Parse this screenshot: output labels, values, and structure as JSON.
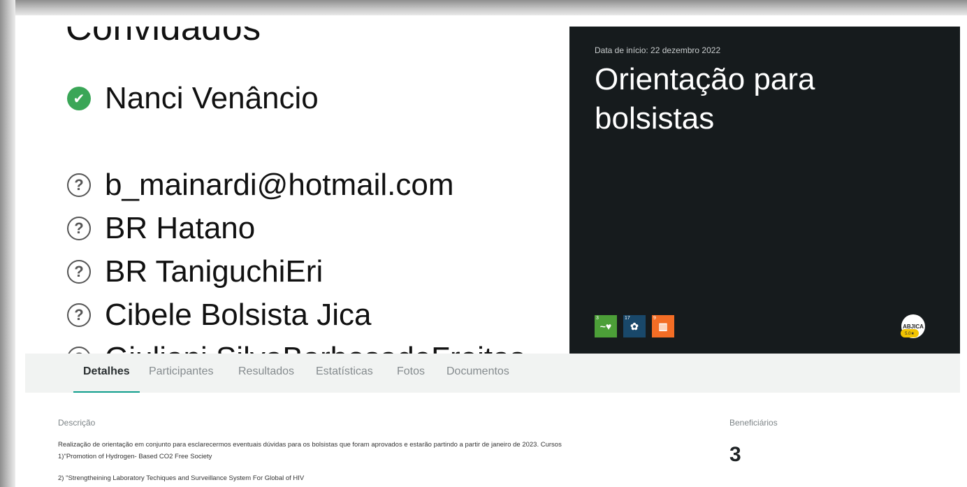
{
  "guests": {
    "title": "Convidados",
    "confirmed": [
      {
        "name": "Nanci Venâncio"
      }
    ],
    "pending": [
      {
        "name": "b_mainardi@hotmail.com"
      },
      {
        "name": "BR Hatano"
      },
      {
        "name": "BR TaniguchiEri"
      },
      {
        "name": "Cibele  Bolsista Jica"
      },
      {
        "name": "Giuliani SilvaBarbosadeFreitas"
      }
    ],
    "icons": {
      "confirmed": "check-circle-icon",
      "pending": "question-circle-icon",
      "check_glyph": "✔",
      "question_glyph": "?"
    }
  },
  "hero": {
    "date_label": "Data de início: 22 dezembro 2022",
    "title": "Orientação para bolsistas",
    "background": "#161b1d",
    "sdg_icons": [
      {
        "number": "3",
        "icon": "sdg-health-icon",
        "color": "#4c9f38",
        "glyph": "~♥"
      },
      {
        "number": "17",
        "icon": "sdg-partnerships-icon",
        "color": "#19486a",
        "glyph": "✿"
      },
      {
        "number": "9",
        "icon": "sdg-industry-icon",
        "color": "#f36d25",
        "glyph": "▥"
      }
    ],
    "logo_text": "ABJICA",
    "logo_badge": "5.0★"
  },
  "tabs": [
    {
      "label": "Detalhes",
      "active": true
    },
    {
      "label": "Participantes",
      "active": false
    },
    {
      "label": "Resultados",
      "active": false
    },
    {
      "label": "Estatísticas",
      "active": false
    },
    {
      "label": "Fotos",
      "active": false
    },
    {
      "label": "Documentos",
      "active": false
    }
  ],
  "accent_color": "#0e9d8b",
  "details": {
    "description_label": "Descrição",
    "description_lines": [
      "Realização de orientação em conjunto para esclarecermos eventuais dúvidas para os bolsistas que foram aprovados e estarão partindo a partir de janeiro de 2023. Cursos",
      "1)\"Promotion of Hydrogen- Based  CO2 Free Society",
      "2) \"Strengtheining Laboratory Techiques and Surveillance System For Global of HIV"
    ],
    "beneficiaries_label": "Beneficiários",
    "beneficiaries_value": "3"
  }
}
